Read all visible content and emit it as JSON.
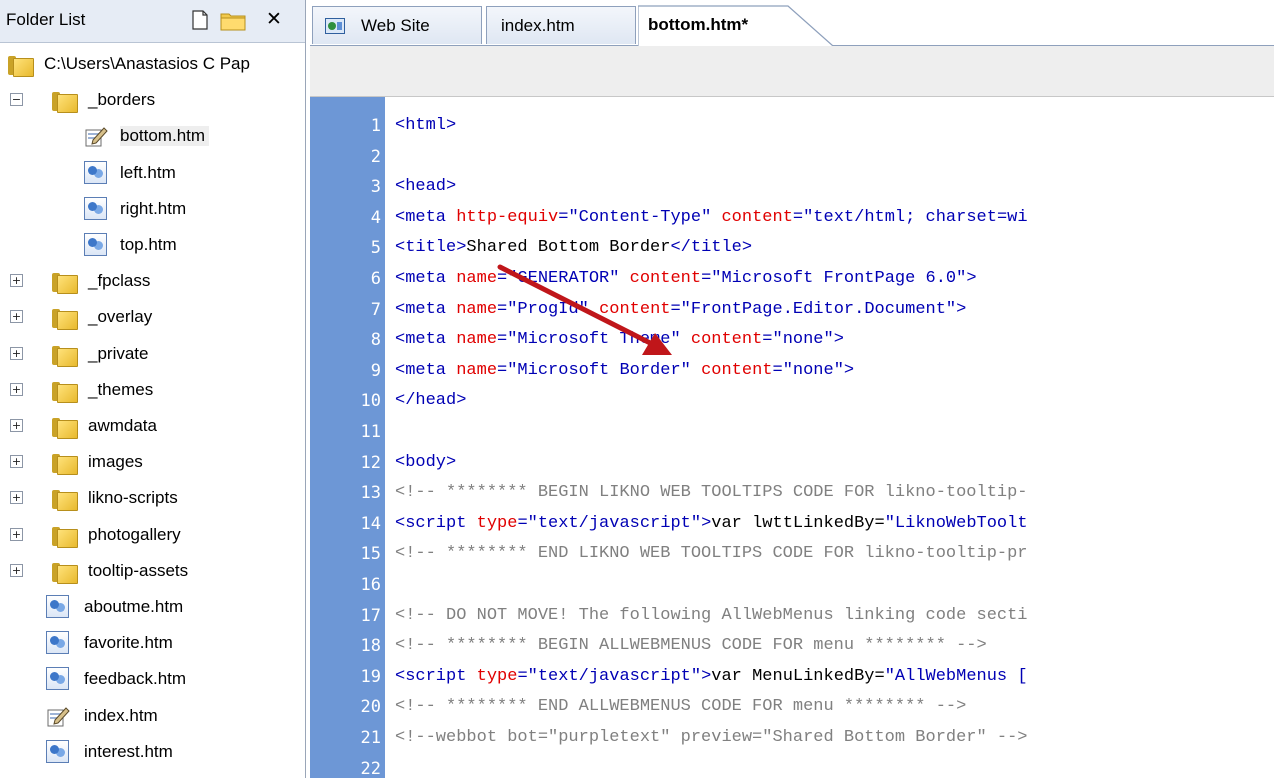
{
  "folder_list": {
    "title": "Folder List",
    "items": [
      {
        "label": "C:\\Users\\Anastasios C Pap",
        "kind": "root-folder"
      },
      {
        "label": "_borders",
        "kind": "folder",
        "expander": "−"
      },
      {
        "label": "bottom.htm",
        "kind": "editing-page"
      },
      {
        "label": "left.htm",
        "kind": "page"
      },
      {
        "label": "right.htm",
        "kind": "page"
      },
      {
        "label": "top.htm",
        "kind": "page"
      },
      {
        "label": "_fpclass",
        "kind": "folder",
        "expander": "+"
      },
      {
        "label": "_overlay",
        "kind": "folder",
        "expander": "+"
      },
      {
        "label": "_private",
        "kind": "folder",
        "expander": "+"
      },
      {
        "label": "_themes",
        "kind": "folder",
        "expander": "+"
      },
      {
        "label": "awmdata",
        "kind": "folder",
        "expander": "+"
      },
      {
        "label": "images",
        "kind": "folder",
        "expander": "+"
      },
      {
        "label": "likno-scripts",
        "kind": "folder",
        "expander": "+"
      },
      {
        "label": "photogallery",
        "kind": "folder",
        "expander": "+"
      },
      {
        "label": "tooltip-assets",
        "kind": "folder",
        "expander": "+"
      },
      {
        "label": "aboutme.htm",
        "kind": "page"
      },
      {
        "label": "favorite.htm",
        "kind": "page"
      },
      {
        "label": "feedback.htm",
        "kind": "page"
      },
      {
        "label": "index.htm",
        "kind": "home-page"
      },
      {
        "label": "interest.htm",
        "kind": "page"
      }
    ]
  },
  "tabs": [
    {
      "label": "Web Site",
      "icon": "web-site-icon"
    },
    {
      "label": "index.htm"
    },
    {
      "label": "bottom.htm*",
      "active": true
    }
  ],
  "colors": {
    "gutter": "#6d97d6",
    "tag": "#0000b4",
    "attribute": "#e00000",
    "comment": "#808080",
    "arrow": "#c0161a"
  },
  "code_lines": [
    {
      "n": "1",
      "parts": [
        {
          "t": "<html>",
          "c": "tag"
        }
      ]
    },
    {
      "n": "2",
      "parts": []
    },
    {
      "n": "3",
      "parts": [
        {
          "t": "<head>",
          "c": "tag"
        }
      ]
    },
    {
      "n": "4",
      "parts": [
        {
          "t": "<meta ",
          "c": "tag"
        },
        {
          "t": "http-equiv",
          "c": "attr"
        },
        {
          "t": "=\"Content-Type\" ",
          "c": "str"
        },
        {
          "t": "content",
          "c": "attr"
        },
        {
          "t": "=\"text/html; charset=wi",
          "c": "str"
        }
      ]
    },
    {
      "n": "5",
      "parts": [
        {
          "t": "<title>",
          "c": "tag"
        },
        {
          "t": "Shared Bottom Border",
          "c": "txt"
        },
        {
          "t": "</title>",
          "c": "tag"
        }
      ]
    },
    {
      "n": "6",
      "parts": [
        {
          "t": "<meta ",
          "c": "tag"
        },
        {
          "t": "name",
          "c": "attr"
        },
        {
          "t": "=\"GENERATOR\" ",
          "c": "str"
        },
        {
          "t": "content",
          "c": "attr"
        },
        {
          "t": "=\"Microsoft FrontPage 6.0\">",
          "c": "str"
        }
      ]
    },
    {
      "n": "7",
      "parts": [
        {
          "t": "<meta ",
          "c": "tag"
        },
        {
          "t": "name",
          "c": "attr"
        },
        {
          "t": "=\"ProgId\" ",
          "c": "str"
        },
        {
          "t": "content",
          "c": "attr"
        },
        {
          "t": "=\"FrontPage.Editor.Document\">",
          "c": "str"
        }
      ]
    },
    {
      "n": "8",
      "parts": [
        {
          "t": "<meta ",
          "c": "tag"
        },
        {
          "t": "name",
          "c": "attr"
        },
        {
          "t": "=\"Microsoft Theme\" ",
          "c": "str"
        },
        {
          "t": "content",
          "c": "attr"
        },
        {
          "t": "=\"none\">",
          "c": "str"
        }
      ]
    },
    {
      "n": "9",
      "parts": [
        {
          "t": "<meta ",
          "c": "tag"
        },
        {
          "t": "name",
          "c": "attr"
        },
        {
          "t": "=\"Microsoft Border\" ",
          "c": "str"
        },
        {
          "t": "content",
          "c": "attr"
        },
        {
          "t": "=\"none\">",
          "c": "str"
        }
      ]
    },
    {
      "n": "10",
      "parts": [
        {
          "t": "</head>",
          "c": "tag"
        }
      ]
    },
    {
      "n": "11",
      "parts": []
    },
    {
      "n": "12",
      "parts": [
        {
          "t": "<body>",
          "c": "tag"
        }
      ]
    },
    {
      "n": "13",
      "parts": [
        {
          "t": "<!-- ******** BEGIN LIKNO WEB TOOLTIPS CODE FOR likno-tooltip-",
          "c": "cmt"
        }
      ]
    },
    {
      "n": "14",
      "parts": [
        {
          "t": "<script ",
          "c": "tag"
        },
        {
          "t": "type",
          "c": "attr"
        },
        {
          "t": "=\"text/javascript\">",
          "c": "str"
        },
        {
          "t": "var lwttLinkedBy=",
          "c": "txt"
        },
        {
          "t": "\"LiknoWebToolt",
          "c": "str"
        }
      ]
    },
    {
      "n": "15",
      "parts": [
        {
          "t": "<!-- ******** END LIKNO WEB TOOLTIPS CODE FOR likno-tooltip-pr",
          "c": "cmt"
        }
      ]
    },
    {
      "n": "16",
      "parts": []
    },
    {
      "n": "17",
      "parts": [
        {
          "t": "<!-- DO NOT MOVE! The following AllWebMenus linking code secti",
          "c": "cmt"
        }
      ]
    },
    {
      "n": "18",
      "parts": [
        {
          "t": "<!-- ******** BEGIN ALLWEBMENUS CODE FOR menu ******** -->",
          "c": "cmt"
        }
      ]
    },
    {
      "n": "19",
      "parts": [
        {
          "t": "<script ",
          "c": "tag"
        },
        {
          "t": "type",
          "c": "attr"
        },
        {
          "t": "=\"text/javascript\">",
          "c": "str"
        },
        {
          "t": "var MenuLinkedBy=",
          "c": "txt"
        },
        {
          "t": "\"AllWebMenus [",
          "c": "str"
        }
      ]
    },
    {
      "n": "20",
      "parts": [
        {
          "t": "<!-- ******** END ALLWEBMENUS CODE FOR menu ******** -->",
          "c": "cmt"
        }
      ]
    },
    {
      "n": "21",
      "parts": [
        {
          "t": "<!--webbot bot=\"purpletext\" preview=\"Shared Bottom Border\" -->",
          "c": "cmt"
        }
      ]
    },
    {
      "n": "22",
      "parts": []
    }
  ]
}
